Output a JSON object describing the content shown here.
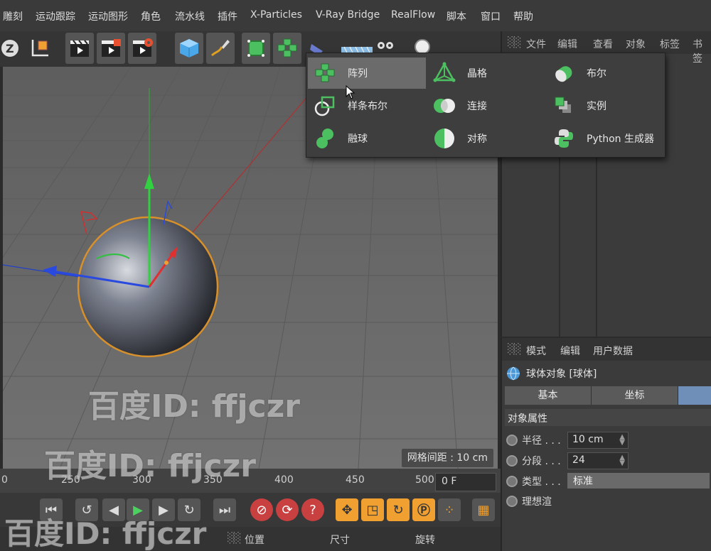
{
  "menubar": {
    "items": [
      "雕刻",
      "运动跟踪",
      "运动图形",
      "角色",
      "流水线",
      "插件",
      "X-Particles",
      "V-Ray Bridge",
      "RealFlow",
      "脚本",
      "窗口",
      "帮助"
    ]
  },
  "toolbar": {
    "icons": [
      "z-axis-icon",
      "coordinate-system-icon",
      "render-view-icon",
      "render-picture-queue-icon",
      "render-settings-icon",
      "cube-icon",
      "pen-icon",
      "subdivision-icon",
      "array-icon",
      "deformer-icon",
      "floor-icon",
      "camera-icon",
      "light-icon"
    ]
  },
  "object_manager": {
    "header": [
      "文件",
      "编辑",
      "查看",
      "对象",
      "标签",
      "书签"
    ]
  },
  "popup": {
    "items": [
      {
        "label": "阵列",
        "icon": "array-icon",
        "highlighted": true
      },
      {
        "label": "晶格",
        "icon": "atom-array-icon"
      },
      {
        "label": "布尔",
        "icon": "boole-icon"
      },
      {
        "label": "样条布尔",
        "icon": "spline-mask-icon"
      },
      {
        "label": "连接",
        "icon": "connect-icon"
      },
      {
        "label": "实例",
        "icon": "instance-icon"
      },
      {
        "label": "融球",
        "icon": "metaball-icon"
      },
      {
        "label": "对称",
        "icon": "symmetry-icon"
      },
      {
        "label": "Python 生成器",
        "icon": "python-generator-icon"
      }
    ]
  },
  "viewport": {
    "grid_label": "网格间距 : 10 cm"
  },
  "attributes": {
    "header": [
      "模式",
      "编辑",
      "用户数据"
    ],
    "object_title": "球体对象 [球体]",
    "tabs": [
      "基本",
      "坐标",
      ""
    ],
    "section": "对象属性",
    "props": [
      {
        "label": "半径 . . .",
        "value": "10 cm"
      },
      {
        "label": "分段 . . .",
        "value": "24"
      },
      {
        "label": "类型 . . .",
        "value": "标准"
      },
      {
        "label": "理想渲",
        "value": ""
      }
    ]
  },
  "timeline": {
    "ticks": [
      "0",
      "250",
      "300",
      "350",
      "400",
      "450",
      "500"
    ],
    "frame": "0 F"
  },
  "coords": {
    "labels": [
      "位置",
      "尺寸",
      "旋转"
    ]
  },
  "watermark": "百度ID: ffjczr"
}
